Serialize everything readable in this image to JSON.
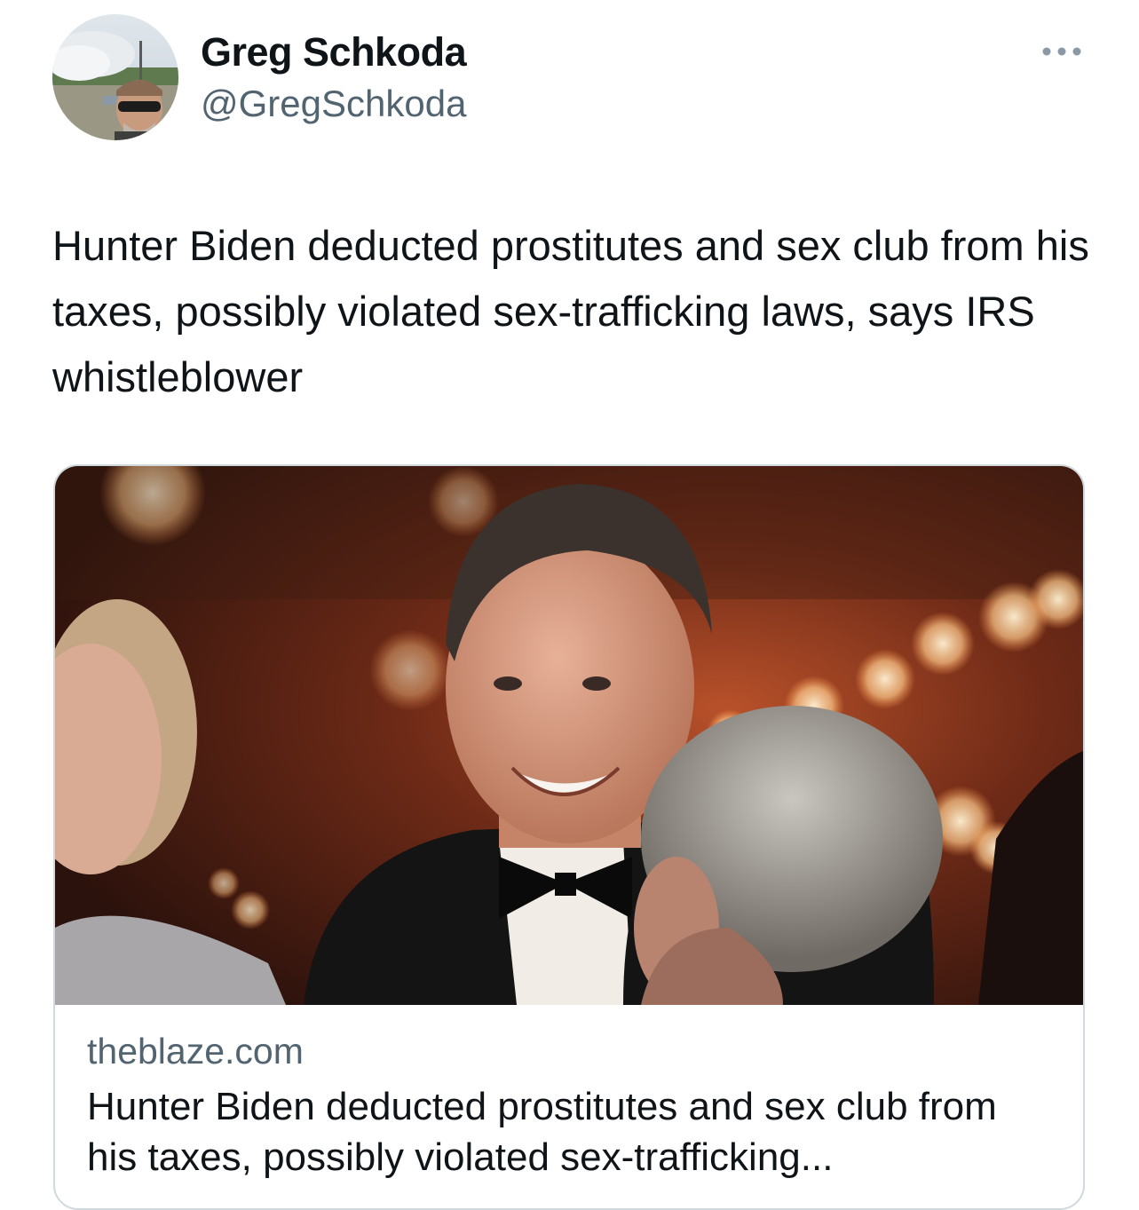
{
  "author": {
    "display_name": "Greg Schkoda",
    "handle": "@GregSchkoda",
    "avatar_icon": "profile-avatar"
  },
  "more_icon": "more-dots-icon",
  "tweet": {
    "text": "Hunter Biden deducted prostitutes and sex club from his taxes, possibly violated sex-trafficking laws, says IRS whistleblower"
  },
  "card": {
    "domain": "theblaze.com",
    "title": "Hunter Biden deducted prostitutes and sex club from his taxes, possibly violated sex-trafficking..."
  },
  "colors": {
    "text_primary": "#0f1419",
    "text_secondary": "#536471",
    "card_border": "#cfd9de"
  }
}
